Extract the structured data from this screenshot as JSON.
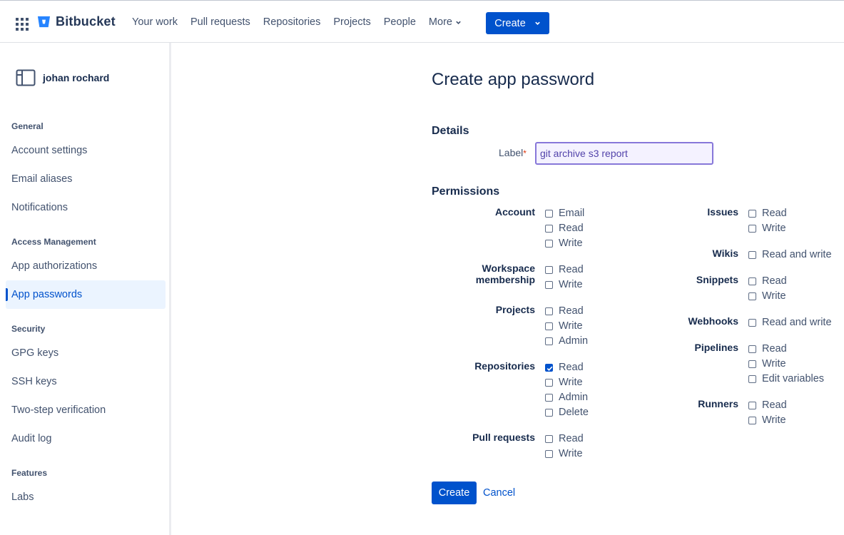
{
  "topnav": {
    "brand": "Bitbucket",
    "items": [
      "Your work",
      "Pull requests",
      "Repositories",
      "Projects",
      "People"
    ],
    "more_label": "More",
    "create_label": "Create"
  },
  "sidebar": {
    "user_name": "johan rochard",
    "sections": {
      "general": "General",
      "access": "Access Management",
      "security": "Security",
      "features": "Features"
    },
    "items": {
      "account_settings": "Account settings",
      "email_aliases": "Email aliases",
      "notifications": "Notifications",
      "app_authorizations": "App authorizations",
      "app_passwords": "App passwords",
      "gpg_keys": "GPG keys",
      "ssh_keys": "SSH keys",
      "two_step": "Two-step verification",
      "audit_log": "Audit log",
      "labs": "Labs"
    },
    "active_item": "app_passwords"
  },
  "main": {
    "title": "Create app password",
    "details_heading": "Details",
    "label_field": {
      "label": "Label",
      "required_mark": "*",
      "value": "git archive s3 report"
    },
    "permissions_heading": "Permissions",
    "permissions": {
      "account": {
        "label": "Account",
        "options": {
          "email": "Email",
          "read": "Read",
          "write": "Write"
        },
        "checked": []
      },
      "workspace": {
        "label_line1": "Workspace",
        "label_line2": "membership",
        "options": {
          "read": "Read",
          "write": "Write"
        },
        "checked": []
      },
      "projects": {
        "label": "Projects",
        "options": {
          "read": "Read",
          "write": "Write",
          "admin": "Admin"
        },
        "checked": []
      },
      "repositories": {
        "label": "Repositories",
        "options": {
          "read": "Read",
          "write": "Write",
          "admin": "Admin",
          "delete": "Delete"
        },
        "checked": [
          "read"
        ]
      },
      "pull_requests": {
        "label": "Pull requests",
        "options": {
          "read": "Read",
          "write": "Write"
        },
        "checked": []
      },
      "issues": {
        "label": "Issues",
        "options": {
          "read": "Read",
          "write": "Write"
        },
        "checked": []
      },
      "wikis": {
        "label": "Wikis",
        "options": {
          "read_write": "Read and write"
        },
        "checked": []
      },
      "snippets": {
        "label": "Snippets",
        "options": {
          "read": "Read",
          "write": "Write"
        },
        "checked": []
      },
      "webhooks": {
        "label": "Webhooks",
        "options": {
          "read_write": "Read and write"
        },
        "checked": []
      },
      "pipelines": {
        "label": "Pipelines",
        "options": {
          "read": "Read",
          "write": "Write",
          "edit_variables": "Edit variables"
        },
        "checked": []
      },
      "runners": {
        "label": "Runners",
        "options": {
          "read": "Read",
          "write": "Write"
        },
        "checked": []
      }
    },
    "create_label": "Create",
    "cancel_label": "Cancel"
  },
  "colors": {
    "primary": "#0052cc",
    "text": "#172b4d",
    "subtle_text": "#42526e",
    "input_border": "#8777d9"
  }
}
